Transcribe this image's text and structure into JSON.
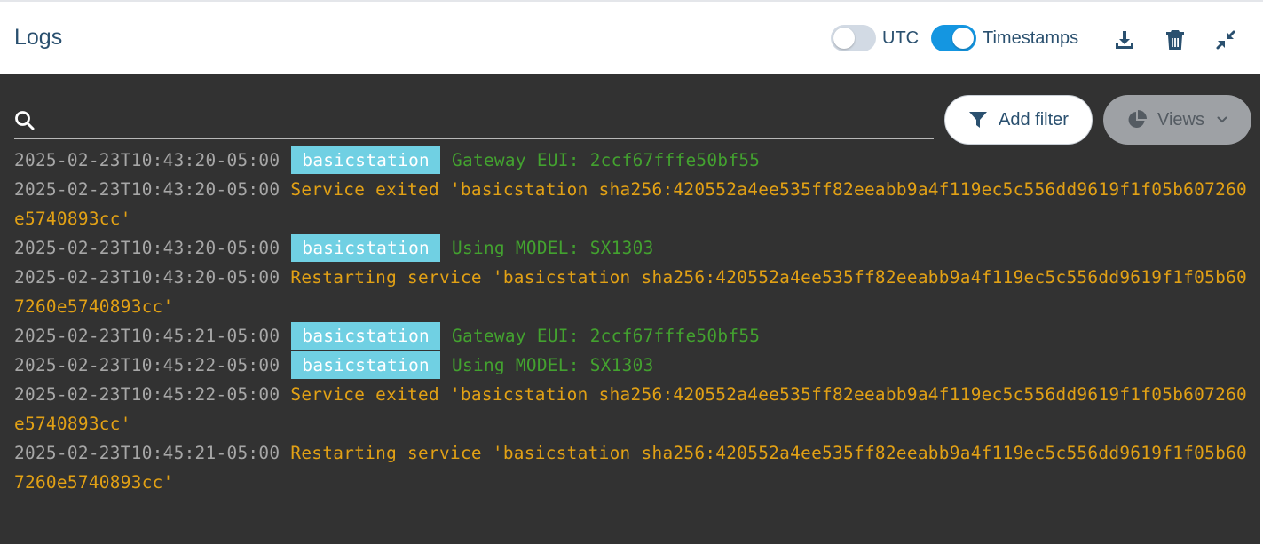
{
  "header": {
    "title": "Logs",
    "utc_label": "UTC",
    "utc_enabled": false,
    "timestamps_label": "Timestamps",
    "timestamps_enabled": true,
    "icons": [
      "download-icon",
      "trash-icon",
      "compress-icon"
    ]
  },
  "search": {
    "placeholder": "",
    "value": ""
  },
  "toolbar": {
    "add_filter_label": "Add filter",
    "views_label": "Views"
  },
  "colors": {
    "accent": "#1496e1",
    "panel_bg": "#323232",
    "badge_bg": "#70d0e3",
    "timestamp": "#a7a7a7",
    "message_green": "#43a22f",
    "message_orange": "#e2a115"
  },
  "logs": [
    {
      "timestamp": "2025-02-23T10:43:20-05:00",
      "service": "basicstation",
      "message": "Gateway EUI: 2ccf67fffe50bf55",
      "kind": "service"
    },
    {
      "timestamp": "2025-02-23T10:43:20-05:00",
      "service": "",
      "message": "Service exited 'basicstation sha256:420552a4ee535ff82eeabb9a4f119ec5c556dd9619f1f05b607260e5740893cc'",
      "kind": "system"
    },
    {
      "timestamp": "2025-02-23T10:43:20-05:00",
      "service": "basicstation",
      "message": "Using MODEL: SX1303",
      "kind": "service"
    },
    {
      "timestamp": "2025-02-23T10:43:20-05:00",
      "service": "",
      "message": "Restarting service 'basicstation sha256:420552a4ee535ff82eeabb9a4f119ec5c556dd9619f1f05b607260e5740893cc'",
      "kind": "system"
    },
    {
      "timestamp": "2025-02-23T10:45:21-05:00",
      "service": "basicstation",
      "message": "Gateway EUI: 2ccf67fffe50bf55",
      "kind": "service"
    },
    {
      "timestamp": "2025-02-23T10:45:22-05:00",
      "service": "basicstation",
      "message": "Using MODEL: SX1303",
      "kind": "service"
    },
    {
      "timestamp": "2025-02-23T10:45:22-05:00",
      "service": "",
      "message": "Service exited 'basicstation sha256:420552a4ee535ff82eeabb9a4f119ec5c556dd9619f1f05b607260e5740893cc'",
      "kind": "system"
    },
    {
      "timestamp": "2025-02-23T10:45:21-05:00",
      "service": "",
      "message": "Restarting service 'basicstation sha256:420552a4ee535ff82eeabb9a4f119ec5c556dd9619f1f05b607260e5740893cc'",
      "kind": "system"
    }
  ]
}
